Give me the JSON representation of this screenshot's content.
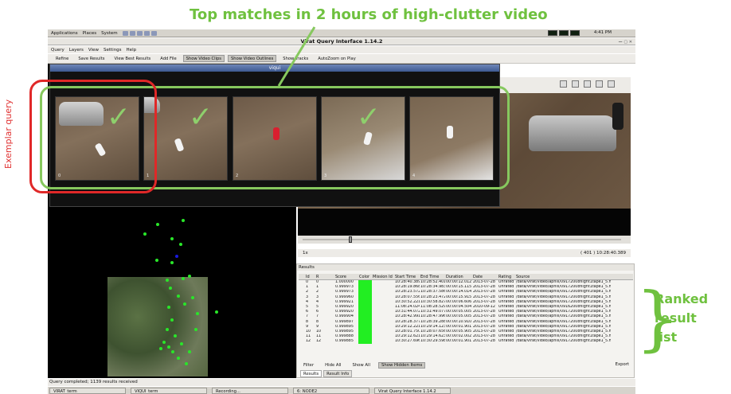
{
  "annotations": {
    "top": "Top matches in 2 hours of high-clutter video",
    "exemplar": "Exemplar query",
    "ranked": [
      "Ranked",
      "result",
      "list"
    ]
  },
  "top_panel": {
    "menus": [
      "Applications",
      "Places",
      "System"
    ],
    "clock": "4:41 PM"
  },
  "window": {
    "title": "Virat Query Interface 1.14.2"
  },
  "menubar": [
    "Query",
    "Layers",
    "View",
    "Settings",
    "Help"
  ],
  "toolbar": [
    {
      "label": "Refine",
      "pressed": false
    },
    {
      "label": "Save Results",
      "pressed": false
    },
    {
      "label": "View Best Results",
      "pressed": false
    },
    {
      "label": "Add File",
      "pressed": false
    },
    {
      "label": "Show Video Clips",
      "pressed": true
    },
    {
      "label": "Show Video Outlines",
      "pressed": true
    },
    {
      "label": "Show Tracks",
      "pressed": false
    },
    {
      "label": "AutoZoom on Play",
      "pressed": false
    }
  ],
  "viqui": {
    "title": "viqui",
    "thumbs": [
      "0",
      "1",
      "2",
      "3",
      "4"
    ]
  },
  "video_status": {
    "left": "1x",
    "right": "( 401 )  10:28:40.389"
  },
  "results": {
    "header": "Results",
    "columns": [
      "",
      "Id",
      "R",
      "",
      "Score",
      "Color",
      "Mission Id",
      "Start Time",
      "End Time",
      "Duration",
      "Date",
      "Rating",
      "Source"
    ],
    "rows": [
      [
        "0",
        "0",
        "1.000000",
        "10:28:40.389",
        "10:28:52.401",
        "00:00:12.012",
        "2013-07-28",
        "Unrated",
        "/data/virat/video/aphill/09172008flight1tape1_5.m"
      ],
      [
        "1",
        "1",
        "0.999973",
        "10:28:19.868",
        "10:28:34.983",
        "00:00:15.115",
        "2013-07-28",
        "Unrated",
        "/data/virat/video/aphill/09172008flight1tape1_5.m"
      ],
      [
        "2",
        "2",
        "0.999973",
        "10:28:23.572",
        "10:28:37.586",
        "00:00:14.014",
        "2013-07-28",
        "Unrated",
        "/data/virat/video/aphill/09172008flight1tape1_5.m"
      ],
      [
        "3",
        "3",
        "0.999960",
        "10:28:07.556",
        "10:28:23.472",
        "00:00:15.915",
        "2013-07-28",
        "Unrated",
        "/data/virat/video/aphill/09172008flight1tape1_5.m"
      ],
      [
        "4",
        "4",
        "0.999921",
        "10:30:52.221",
        "10:30:58.827",
        "00:00:06.606",
        "2013-07-28",
        "Unrated",
        "/data/virat/video/aphill/09172008flight1tape1_5.m"
      ],
      [
        "5",
        "5",
        "0.999920",
        "11:08:24.024",
        "11:08:28.529",
        "00:00:04.504",
        "2010-09-12",
        "Unrated",
        "/data/virat/video/aphill/09162008flight1tape1_5.m"
      ],
      [
        "6",
        "6",
        "0.999920",
        "10:31:44.072",
        "10:31:49.077",
        "00:00:05.005",
        "2013-07-28",
        "Unrated",
        "/data/virat/video/aphill/09172008flight1tape1_5.m"
      ],
      [
        "7",
        "7",
        "0.999904",
        "10:28:42.991",
        "10:28:47.996",
        "00:00:05.005",
        "2013-07-28",
        "Unrated",
        "/data/virat/video/aphill/09172008flight1tape1_5.m"
      ],
      [
        "8",
        "8",
        "0.999897",
        "10:28:28.377",
        "10:28:39.288",
        "00:00:10.910",
        "2013-07-28",
        "Unrated",
        "/data/virat/video/aphill/09172008flight1tape1_5.m"
      ],
      [
        "9",
        "9",
        "0.999895",
        "10:29:12.221",
        "10:29:14.123",
        "00:00:01.901",
        "2013-07-28",
        "Unrated",
        "/data/virat/video/aphill/09172008flight1tape1_5.m"
      ],
      [
        "10",
        "10",
        "0.999895",
        "10:28:01.750",
        "10:28:07.656",
        "00:00:05.905",
        "2013-07-28",
        "Unrated",
        "/data/virat/video/aphill/09172008flight1tape1_5.m"
      ],
      [
        "11",
        "11",
        "0.999888",
        "10:29:12.621",
        "10:29:14.623",
        "00:00:02.002",
        "2013-07-28",
        "Unrated",
        "/data/virat/video/aphill/09172008flight1tape1_5.m"
      ],
      [
        "12",
        "12",
        "0.999885",
        "10:30:27.696",
        "10:30:29.598",
        "00:00:01.901",
        "2013-07-28",
        "Unrated",
        "/data/virat/video/aphill/09172008flight1tape1_5.m"
      ]
    ],
    "buttons": [
      {
        "label": "Filter",
        "pressed": false
      },
      {
        "label": "Hide All",
        "pressed": false
      },
      {
        "label": "Show All",
        "pressed": false
      },
      {
        "label": "Show Hidden Items",
        "pressed": true
      }
    ],
    "export": "Export",
    "tabs": [
      "Results",
      "Result Info"
    ]
  },
  "query_status": "Query completed; 1139 results received",
  "taskbar": [
    "VIRAT_term",
    "VIQUI_term",
    "Recording...",
    "6: NODE2",
    "Virat Query Interface 1.14.2"
  ],
  "colors": {
    "highlight_green": "#6fc13f",
    "exemplar_red": "#e02828",
    "result_green": "#22ee22"
  }
}
